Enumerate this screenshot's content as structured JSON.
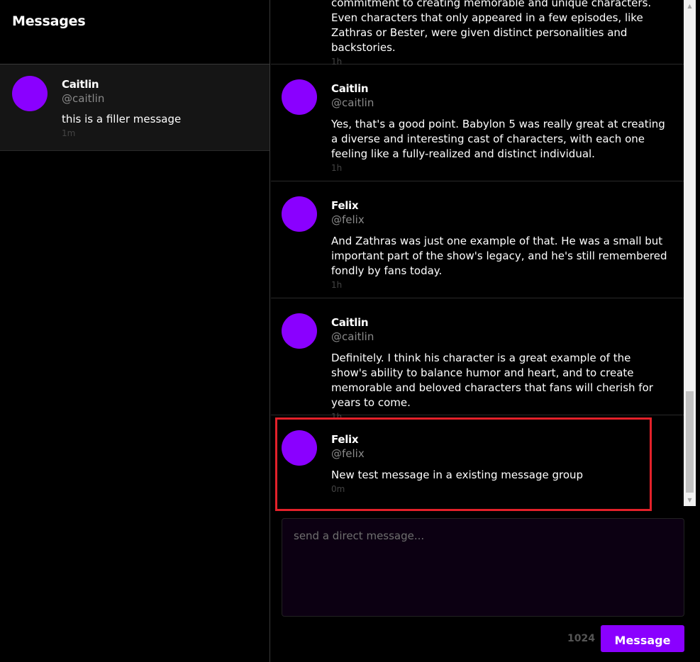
{
  "sidebar": {
    "title": "Messages",
    "conversations": [
      {
        "name": "Caitlin",
        "handle": "@caitlin",
        "preview": "this is a filler message",
        "time": "1m"
      }
    ]
  },
  "thread": {
    "messages": [
      {
        "name": "",
        "handle": "",
        "body": "commitment to creating memorable and unique characters. Even characters that only appeared in a few episodes, like Zathras or Bester, were given distinct personalities and backstories.",
        "time": "1h"
      },
      {
        "name": "Caitlin",
        "handle": "@caitlin",
        "body": "Yes, that's a good point. Babylon 5 was really great at creating a diverse and interesting cast of characters, with each one feeling like a fully-realized and distinct individual.",
        "time": "1h"
      },
      {
        "name": "Felix",
        "handle": "@felix",
        "body": "And Zathras was just one example of that. He was a small but important part of the show's legacy, and he's still remembered fondly by fans today.",
        "time": "1h"
      },
      {
        "name": "Caitlin",
        "handle": "@caitlin",
        "body": "Definitely. I think his character is a great example of the show's ability to balance humor and heart, and to create memorable and beloved characters that fans will cherish for years to come.",
        "time": "1h"
      },
      {
        "name": "Felix",
        "handle": "@felix",
        "body": "New test message in a existing message group",
        "time": "0m"
      }
    ]
  },
  "composer": {
    "placeholder": "send a direct message...",
    "char_count": "1024",
    "send_label": "Message"
  },
  "colors": {
    "accent": "#8a00ff",
    "highlight": "#e3212a",
    "background": "#000000"
  }
}
